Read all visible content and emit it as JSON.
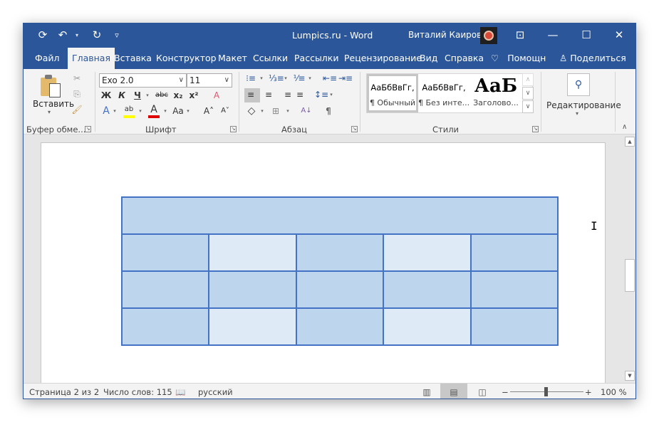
{
  "titlebar": {
    "document_title": "Lumpics.ru  -  Word",
    "user_name": "Виталий Каиров",
    "qat": [
      {
        "icon": "autosave-icon",
        "glyph": "⟳"
      },
      {
        "icon": "undo-icon",
        "glyph": "↶"
      },
      {
        "icon": "redo-icon",
        "glyph": "↻"
      },
      {
        "icon": "customize-qat-icon",
        "glyph": "▿"
      }
    ],
    "window_buttons": [
      {
        "name": "ribbon-display-options-button",
        "icon": "ribbon-display-icon",
        "glyph": "⊡"
      },
      {
        "name": "minimize-button",
        "icon": "minimize-icon",
        "glyph": "—"
      },
      {
        "name": "maximize-button",
        "icon": "maximize-icon",
        "glyph": "☐"
      },
      {
        "name": "close-button",
        "icon": "close-icon",
        "glyph": "✕"
      }
    ]
  },
  "tabs": [
    {
      "label": "Файл",
      "active": false
    },
    {
      "label": "Главная",
      "active": true
    },
    {
      "label": "Вставка",
      "active": false
    },
    {
      "label": "Конструктор",
      "active": false
    },
    {
      "label": "Макет",
      "active": false
    },
    {
      "label": "Ссылки",
      "active": false
    },
    {
      "label": "Рассылки",
      "active": false
    },
    {
      "label": "Рецензирование",
      "active": false
    },
    {
      "label": "Вид",
      "active": false
    },
    {
      "label": "Справка",
      "active": false
    }
  ],
  "tell_me": {
    "icon": "lightbulb-icon",
    "glyph": "♡",
    "label": "Помощн"
  },
  "share": {
    "icon": "share-person-icon",
    "glyph": "♙",
    "label": "Поделиться"
  },
  "ribbon": {
    "clipboard": {
      "label": "Буфер обме...",
      "paste_label": "Вставить",
      "dropdown_glyph": "▾",
      "cut_glyph": "✂",
      "copy_glyph": "⎘",
      "format_painter_glyph": "🖌"
    },
    "font": {
      "label": "Шрифт",
      "font_name": "Exo 2.0",
      "font_size": "11",
      "chev": "∨",
      "bold": "Ж",
      "italic": "К",
      "underline": "Ч",
      "strike": "abc",
      "subscript": "x₂",
      "superscript": "x²",
      "clear_formatting": "A",
      "text_effects": "A",
      "highlight": "ab",
      "font_color": "A",
      "change_case": "Aa",
      "grow_font": "A˄",
      "shrink_font": "A˅",
      "dd": "▾",
      "highlight_color": "#ffff00",
      "font_color_bar": "#e00000"
    },
    "paragraph": {
      "label": "Абзац",
      "bullets": "⁝≡",
      "numbering": "⅓≡",
      "multilevel": "⅟≡",
      "decrease_indent": "⇤≡",
      "increase_indent": "⇥≡",
      "align_left": "≡",
      "center": "≡",
      "align_right": "≡",
      "justify": "≡",
      "line_spacing": "↕≡",
      "shading": "◇",
      "borders": "⊞",
      "sort": "А↓",
      "show_marks": "¶",
      "dd": "▾"
    },
    "styles": {
      "label": "Стили",
      "items": [
        {
          "sample": "АаБбВвГг,",
          "name": "¶ Обычный",
          "selected": true
        },
        {
          "sample": "АаБбВвГг,",
          "name": "¶ Без инте...",
          "selected": false
        },
        {
          "sample": "АаБ",
          "name": "Заголово...",
          "selected": false
        }
      ],
      "scroll_up": "∧",
      "scroll_down": "∨",
      "more": "⩡"
    },
    "editing": {
      "label": "Редактирование",
      "icon_glyph": "⚲",
      "dd": "▾"
    },
    "collapse_glyph": "∧",
    "launcher_glyph": "↘"
  },
  "document": {
    "table": {
      "rows": [
        [
          "dark"
        ],
        [
          "dark",
          "light",
          "dark",
          "light",
          "dark"
        ],
        [
          "dark",
          "dark",
          "dark",
          "dark",
          "dark"
        ],
        [
          "dark",
          "light",
          "dark",
          "light",
          "dark"
        ]
      ],
      "colors": {
        "border": "#4472c4",
        "dark": "#bdd6ee",
        "light": "#deeaf6"
      }
    },
    "cursor_glyph": "I"
  },
  "scrollbar": {
    "up": "▲",
    "down": "▼"
  },
  "statusbar": {
    "page": "Страница 2 из 2",
    "words": "Число слов: 115",
    "proofing_glyph": "📖",
    "language": "русский",
    "read_mode_glyph": "▥",
    "print_layout_glyph": "▤",
    "web_layout_glyph": "◫",
    "zoom_out": "−",
    "zoom_in": "+",
    "zoom_level": "100 %",
    "zoom_percent": 100
  },
  "colors": {
    "accent": "#2b579a"
  }
}
